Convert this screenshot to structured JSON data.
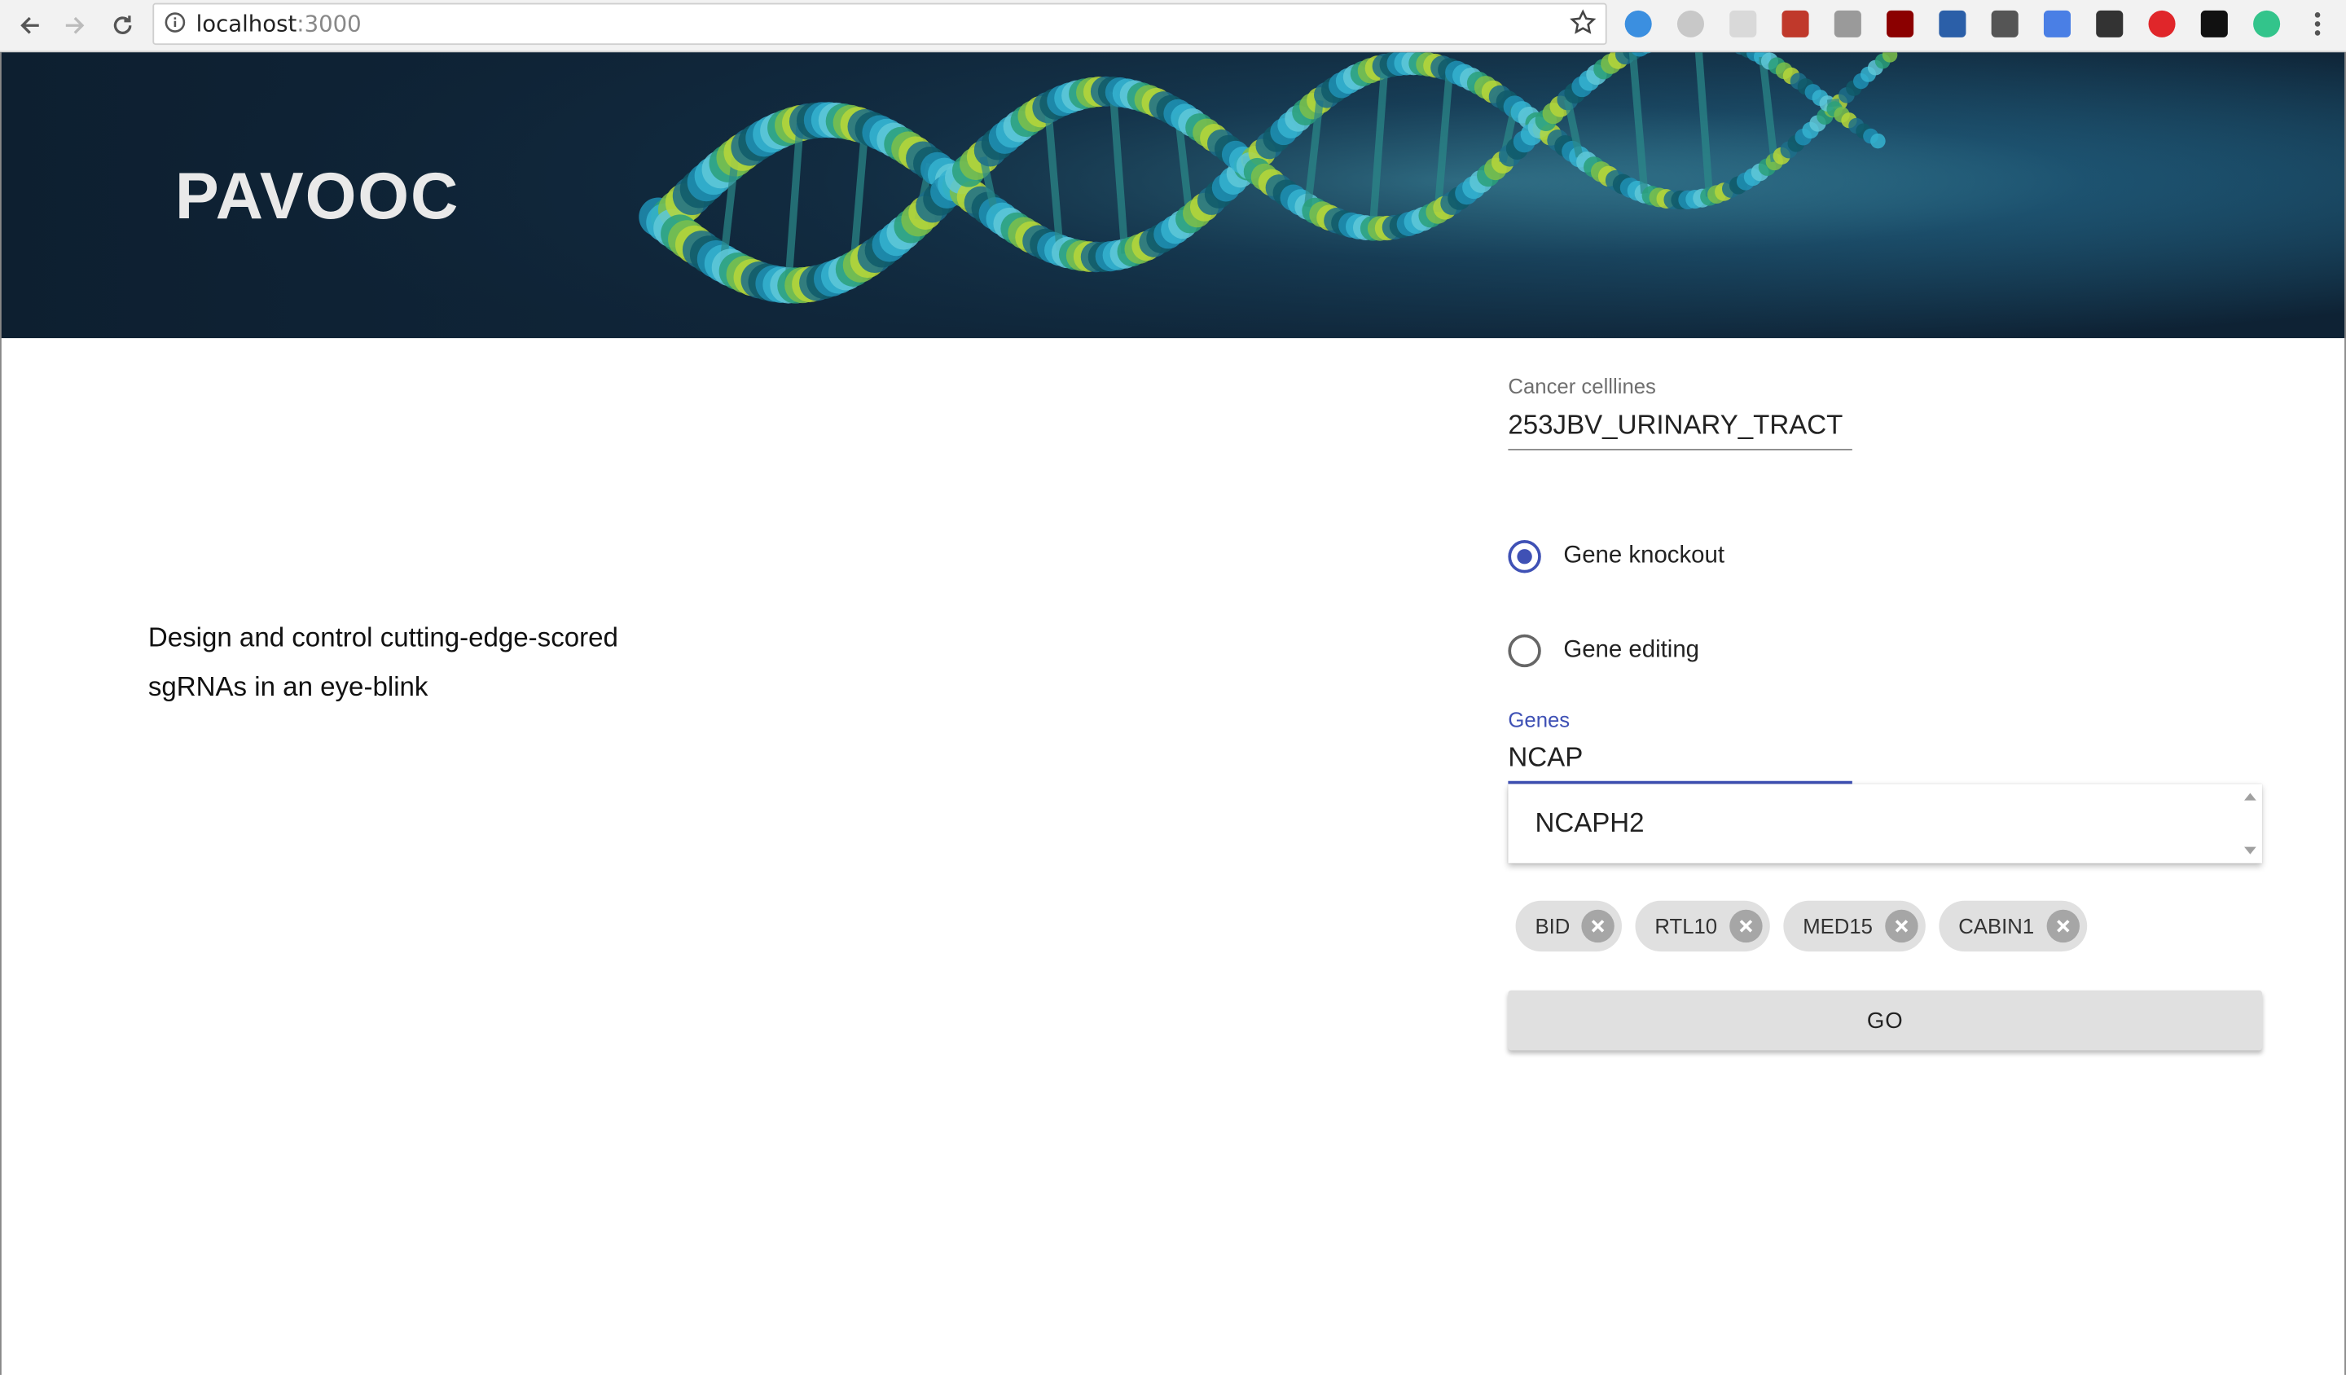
{
  "browser": {
    "url_host": "localhost",
    "url_port": ":3000",
    "extensions": [
      {
        "icon": "feather-icon",
        "color": "#3b8fe0"
      },
      {
        "icon": "swirl-icon",
        "color": "#c8c8c8"
      },
      {
        "icon": "notes-icon",
        "color": "#d9d9d9"
      },
      {
        "icon": "bug-icon",
        "color": "#c0392b"
      },
      {
        "icon": "image-icon",
        "color": "#9a9a9a"
      },
      {
        "icon": "ublock-icon",
        "color": "#8b0000"
      },
      {
        "icon": "nb-icon",
        "color": "#2b5fa8"
      },
      {
        "icon": "plug-icon",
        "color": "#555555"
      },
      {
        "icon": "translate-icon",
        "color": "#4a7fe5"
      },
      {
        "icon": "bulb-icon",
        "color": "#333333"
      },
      {
        "icon": "vivaldi-icon",
        "color": "#e0262a"
      },
      {
        "icon": "gnome-icon",
        "color": "#111111"
      },
      {
        "icon": "circle-icon",
        "color": "#33c48b"
      }
    ]
  },
  "banner": {
    "title": "PAVOOC"
  },
  "tagline": {
    "line1": "Design and control cutting-edge-scored",
    "line2": "sgRNAs in an eye-blink"
  },
  "form": {
    "cellline_label": "Cancer celllines",
    "cellline_value": "253JBV_URINARY_TRACT",
    "mode_options": [
      {
        "label": "Gene knockout",
        "selected": true
      },
      {
        "label": "Gene editing",
        "selected": false
      }
    ],
    "genes_label": "Genes",
    "genes_value": "NCAP",
    "suggestion": "NCAPH2",
    "chips": [
      "BID",
      "RTL10",
      "MED15",
      "CABIN1"
    ],
    "go_label": "GO"
  },
  "colors": {
    "accent": "#3f51b5",
    "chip_bg": "#e0e0e0",
    "banner_bg": "#0e2234"
  }
}
